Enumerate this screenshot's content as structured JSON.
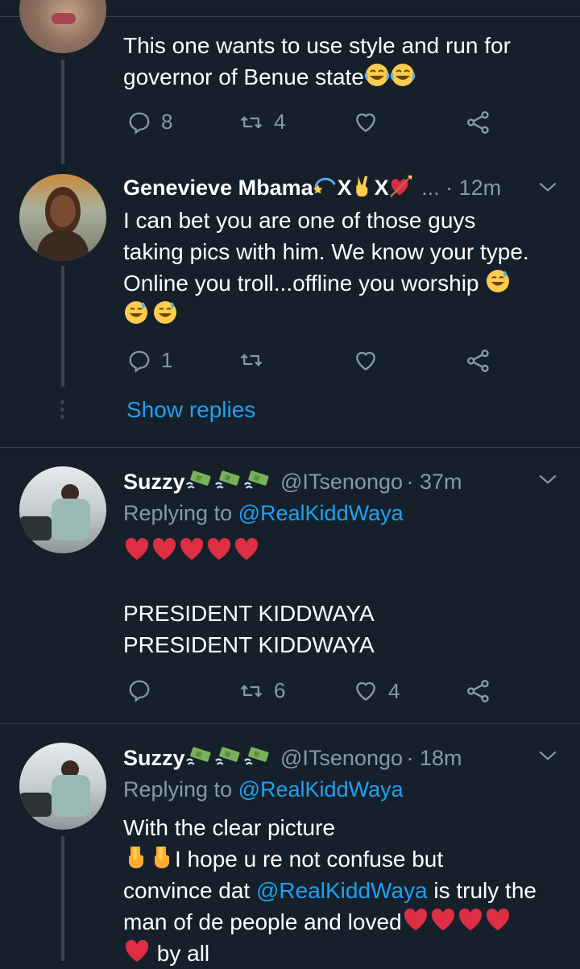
{
  "colors": {
    "background": "#15202b",
    "accent": "#1da1f2",
    "muted": "#8899a6",
    "line": "#38444d",
    "heart": "#dd2e44"
  },
  "tweet1": {
    "text_line1": "This one wants to use style and run for",
    "text_line2": "governor of Benue state",
    "replies": "8",
    "retweets": "4",
    "likes": ""
  },
  "tweet2": {
    "name": "Genevieve Mbama",
    "name_suffix": "X",
    "name_suffix2": "X",
    "time": "... · 12m",
    "line1": "I can bet you are one of those guys",
    "line2": "taking pics with him. We know your type.",
    "line3": "Online you troll...offline you worship",
    "replies": "1",
    "retweets": "",
    "likes": "",
    "show_replies": "Show replies"
  },
  "tweet3": {
    "name": "Suzzy",
    "handle": "@ITsenongo",
    "time": "· 37m",
    "replying_label": "Replying to",
    "replying_handle": "@RealKiddWaya",
    "line1": "PRESIDENT KIDDWAYA",
    "line2": "PRESIDENT KIDDWAYA",
    "replies": "",
    "retweets": "6",
    "likes": "4"
  },
  "tweet4": {
    "name": "Suzzy",
    "handle": "@ITsenongo",
    "time": "· 18m",
    "replying_label": "Replying to",
    "replying_handle": "@RealKiddWaya",
    "line1": "With the clear picture",
    "line2": "I hope u re not confuse but",
    "line3_a": "convince dat",
    "line3_mention": "@RealKiddWaya",
    "line3_b": "is truly the",
    "line4": "man of de people and loved",
    "line5": "by all"
  }
}
